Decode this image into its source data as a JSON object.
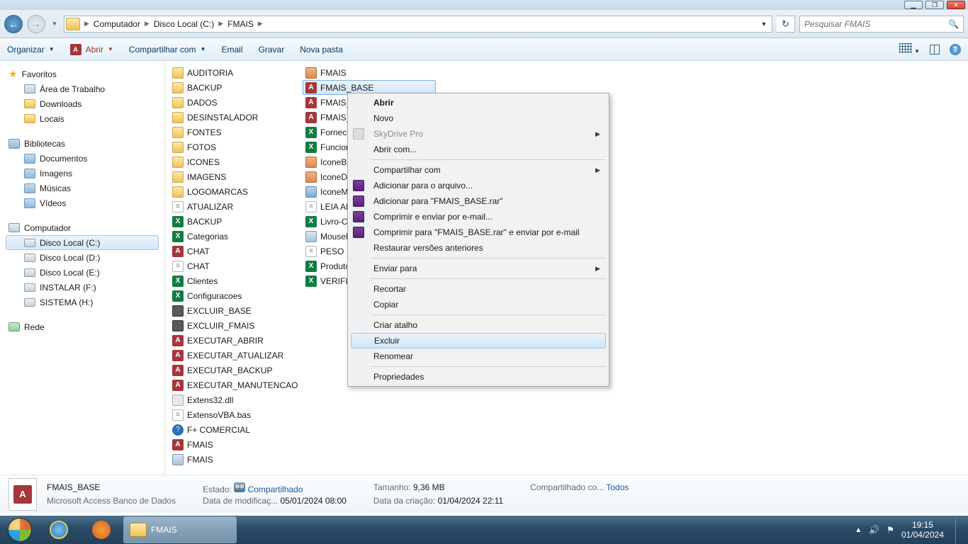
{
  "window_controls": {
    "minimize": "▁",
    "maximize": "❐",
    "close": "✕"
  },
  "nav": {
    "breadcrumb": [
      "Computador",
      "Disco Local (C:)",
      "FMAIS"
    ],
    "search_placeholder": "Pesquisar FMAIS"
  },
  "cmdbar": {
    "organize": "Organizar",
    "open": "Abrir",
    "share": "Compartilhar com",
    "email": "Email",
    "burn": "Gravar",
    "newfolder": "Nova pasta"
  },
  "navpane": {
    "favorites": {
      "label": "Favoritos",
      "items": [
        "Área de Trabalho",
        "Downloads",
        "Locais"
      ]
    },
    "libraries": {
      "label": "Bibliotecas",
      "items": [
        "Documentos",
        "Imagens",
        "Músicas",
        "Vídeos"
      ]
    },
    "computer": {
      "label": "Computador",
      "items": [
        "Disco Local (C:)",
        "Disco Local (D:)",
        "Disco Local (E:)",
        "INSTALAR (F:)",
        "SISTEMA (H:)"
      ]
    },
    "network": {
      "label": "Rede"
    }
  },
  "files": {
    "col1": [
      {
        "t": "folder",
        "n": "AUDITORIA"
      },
      {
        "t": "folder",
        "n": "BACKUP"
      },
      {
        "t": "folder",
        "n": "DADOS"
      },
      {
        "t": "folder",
        "n": "DESINSTALADOR"
      },
      {
        "t": "folder",
        "n": "FONTES"
      },
      {
        "t": "folder",
        "n": "FOTOS"
      },
      {
        "t": "folder",
        "n": "ICONES"
      },
      {
        "t": "folder",
        "n": "IMAGENS"
      },
      {
        "t": "folder",
        "n": "LOGOMARCAS"
      },
      {
        "t": "txt",
        "n": "ATUALIZAR"
      },
      {
        "t": "xls",
        "n": "BACKUP"
      },
      {
        "t": "xls",
        "n": "Categorias"
      },
      {
        "t": "access",
        "n": "CHAT"
      },
      {
        "t": "txt",
        "n": "CHAT"
      },
      {
        "t": "xls",
        "n": "Clientes"
      },
      {
        "t": "xls",
        "n": "Configuracoes"
      },
      {
        "t": "bat",
        "n": "EXCLUIR_BASE"
      },
      {
        "t": "bat",
        "n": "EXCLUIR_FMAIS"
      },
      {
        "t": "access",
        "n": "EXECUTAR_ABRIR"
      },
      {
        "t": "access",
        "n": "EXECUTAR_ATUALIZAR"
      },
      {
        "t": "access",
        "n": "EXECUTAR_BACKUP"
      },
      {
        "t": "access",
        "n": "EXECUTAR_MANUTENCAO"
      },
      {
        "t": "dll",
        "n": "Extens32.dll"
      },
      {
        "t": "txt",
        "n": "ExtensoVBA.bas"
      },
      {
        "t": "chm",
        "n": "F+ COMERCIAL"
      },
      {
        "t": "access",
        "n": "FMAIS"
      },
      {
        "t": "exe",
        "n": "FMAIS"
      }
    ],
    "col2": [
      {
        "t": "img",
        "n": "FMAIS"
      },
      {
        "t": "access",
        "n": "FMAIS_BASE",
        "selected": true
      },
      {
        "t": "access",
        "n": "FMAIS_C"
      },
      {
        "t": "access",
        "n": "FMAIS_P"
      },
      {
        "t": "xls",
        "n": "Fornece"
      },
      {
        "t": "xls",
        "n": "Funcion"
      },
      {
        "t": "img",
        "n": "IconeBa"
      },
      {
        "t": "img",
        "n": "IconeDe"
      },
      {
        "t": "reg",
        "n": "IconeMa"
      },
      {
        "t": "txt",
        "n": "LEIA AN"
      },
      {
        "t": "xls",
        "n": "Livro-Ca"
      },
      {
        "t": "exe",
        "n": "MouseH"
      },
      {
        "t": "txt",
        "n": "PESO"
      },
      {
        "t": "xls",
        "n": "Produto"
      },
      {
        "t": "xls",
        "n": "VERIFICA"
      }
    ]
  },
  "context_menu": {
    "abrir": "Abrir",
    "novo": "Novo",
    "skydrive": "SkyDrive Pro",
    "abrircom": "Abrir com...",
    "compartilhar": "Compartilhar com",
    "addarq": "Adicionar para o arquivo...",
    "addrar": "Adicionar para \"FMAIS_BASE.rar\"",
    "compemail": "Comprimir e enviar por e-mail...",
    "comprar": "Comprimir para \"FMAIS_BASE.rar\" e enviar por e-mail",
    "restaurar": "Restaurar versões anteriores",
    "enviar": "Enviar para",
    "recortar": "Recortar",
    "copiar": "Copiar",
    "atalho": "Criar atalho",
    "excluir": "Excluir",
    "renomear": "Renomear",
    "props": "Propriedades"
  },
  "details": {
    "filename": "FMAIS_BASE",
    "filetype": "Microsoft Access Banco de Dados",
    "estado_lbl": "Estado:",
    "estado_val": "Compartilhado",
    "datamod_lbl": "Data de modificaç...",
    "datamod_val": "05/01/2024 08:00",
    "tamanho_lbl": "Tamanho:",
    "tamanho_val": "9,36 MB",
    "datacri_lbl": "Data da criação:",
    "datacri_val": "01/04/2024 22:11",
    "compart_lbl": "Compartilhado co...",
    "compart_val": "Todos"
  },
  "taskbar": {
    "window_label": "FMAIS",
    "time": "19:15",
    "date": "01/04/2024"
  }
}
